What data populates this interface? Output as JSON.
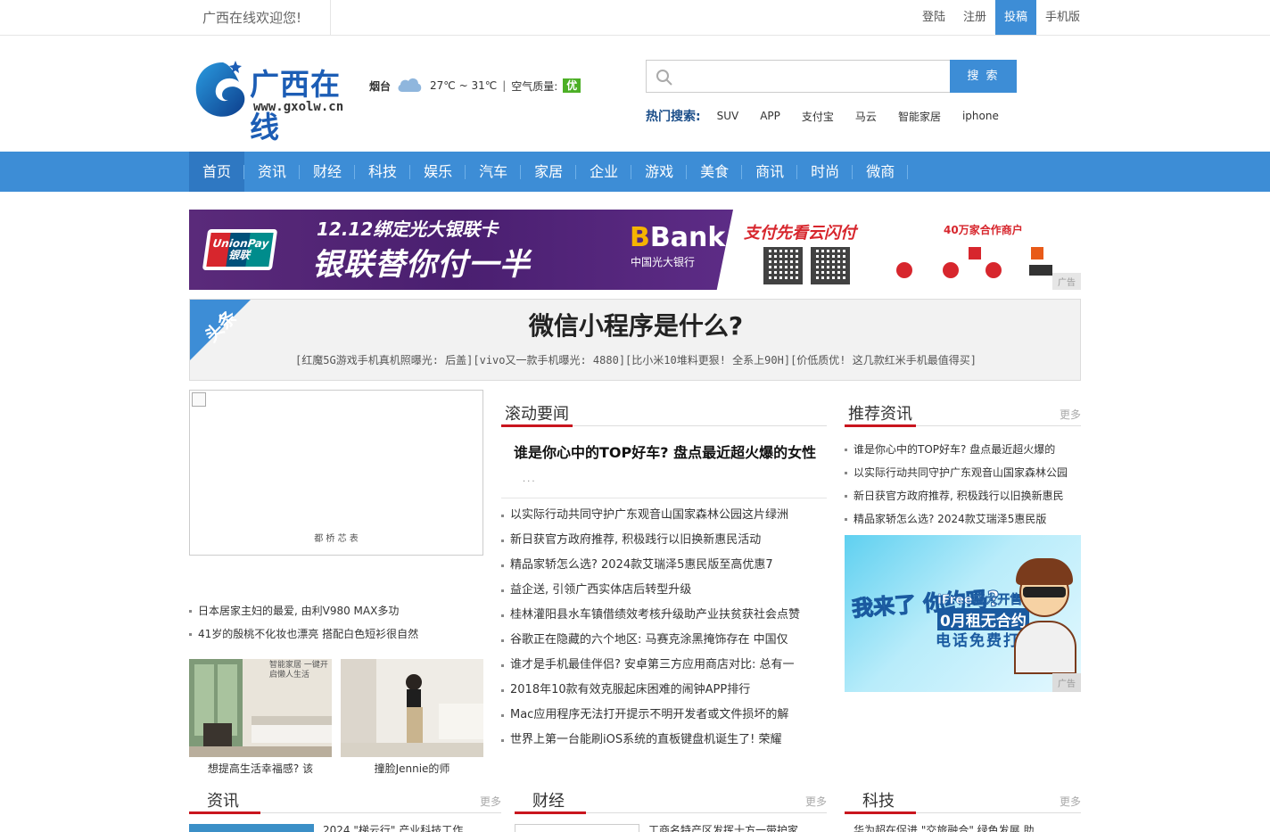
{
  "topbar": {
    "welcome": "广西在线欢迎您!",
    "links": [
      "登陆",
      "注册",
      "投稿",
      "手机版"
    ],
    "active_link": "投稿"
  },
  "logo": {
    "brand": "广西在线",
    "url": "www.gxolw.cn"
  },
  "weather": {
    "city": "烟台",
    "icon": "cloud-icon",
    "temp": "27℃ ~ 31℃",
    "separator": "|",
    "air_label": "空气质量:",
    "air_value": "优"
  },
  "search": {
    "value": "",
    "placeholder": "",
    "button": "搜 索"
  },
  "hot_search": {
    "label": "热门搜索:",
    "items": [
      "SUV",
      "APP",
      "支付宝",
      "马云",
      "智能家居",
      "iphone"
    ]
  },
  "nav": {
    "items": [
      "首页",
      "资讯",
      "财经",
      "科技",
      "娱乐",
      "汽车",
      "家居",
      "企业",
      "游戏",
      "美食",
      "商讯",
      "时尚",
      "微商"
    ],
    "active": "首页"
  },
  "banner": {
    "line1": "12.12绑定光大银联卡",
    "line2": "银联替你付一半",
    "unionpay_text": "UnionPay 银联",
    "bank_logo": "Bank",
    "bank_name": "中国光大银行",
    "right_title": "支付先看云闪付",
    "merchants": "40万家合作商户",
    "ad_tag": "广告"
  },
  "headline": {
    "ribbon": "头条",
    "title": "微信小程序是什么?",
    "links": "[红魔5G游戏手机真机照曝光: 后盖][vivo又一款手机曝光: 4880][比小米10堆料更狠! 全系上90H][价低质优! 这几款红米手机最值得买]"
  },
  "left": {
    "image_caption": "都 桥 芯 表",
    "list": [
      "日本居家主妇的最爱, 由利V980 MAX多功",
      "41岁的殷桃不化妆也漂亮 搭配白色短衫很自然"
    ],
    "thumbs": [
      {
        "caption": "想提高生活幸福感? 该",
        "overlay": "智能家居 一键开启懒人生活"
      },
      {
        "caption": "撞脸Jennie的师"
      }
    ]
  },
  "middle": {
    "section_title": "滚动要闻",
    "top_title": "谁是你心中的TOP好车? 盘点最近超火爆的女性",
    "dots": "...",
    "list": [
      "以实际行动共同守护广东观音山国家森林公园这片绿洲",
      "新日获官方政府推荐, 积极践行以旧换新惠民活动",
      "精品家轿怎么选? 2024款艾瑞泽5惠民版至高优惠7",
      "益企送, 引领广西实体店后转型升级",
      "桂林灌阳县水车镇借绩效考核升级助产业扶贫获社会点赞",
      "谷歌正在隐藏的六个地区: 马赛克涂黑掩饰存在 中国仅",
      "谁才是手机最佳伴侣? 安卓第三方应用商店对比: 总有一",
      "2018年10款有效克服起床困难的闹钟APP排行",
      "Mac应用程序无法打开提示不明开发者或文件损坏的解",
      "世界上第一台能刷iOS系统的直板键盘机诞生了! 荣耀"
    ]
  },
  "right": {
    "section_title": "推荐资讯",
    "more": "更多",
    "list": [
      "谁是你心中的TOP好车? 盘点最近超火爆的",
      "以实际行动共同守护广东观音山国家森林公园",
      "新日获官方政府推荐, 积极践行以旧换新惠民",
      "精品家轿怎么选? 2024款艾瑞泽5惠民版"
    ],
    "ad": {
      "big": "我来了 你约吗?",
      "t1": "iFree盛大开售",
      "t2": "0月租无合约",
      "t3": "电话免费打",
      "tag": "广告"
    }
  },
  "bottom": {
    "sections": [
      {
        "title": "资讯",
        "more": "更多",
        "first": "2024 \"梯云行\" 产业科技工作"
      },
      {
        "title": "财经",
        "more": "更多",
        "first": "工商名特产区发挥十方一带护家"
      },
      {
        "title": "科技",
        "more": "更多",
        "first": "华为超在促进 \"交旅融合\" 绿色发展 助"
      }
    ]
  },
  "colors": {
    "primary": "#3d8dd6",
    "accent_red": "#c9151e",
    "air_good": "#4caf26"
  }
}
